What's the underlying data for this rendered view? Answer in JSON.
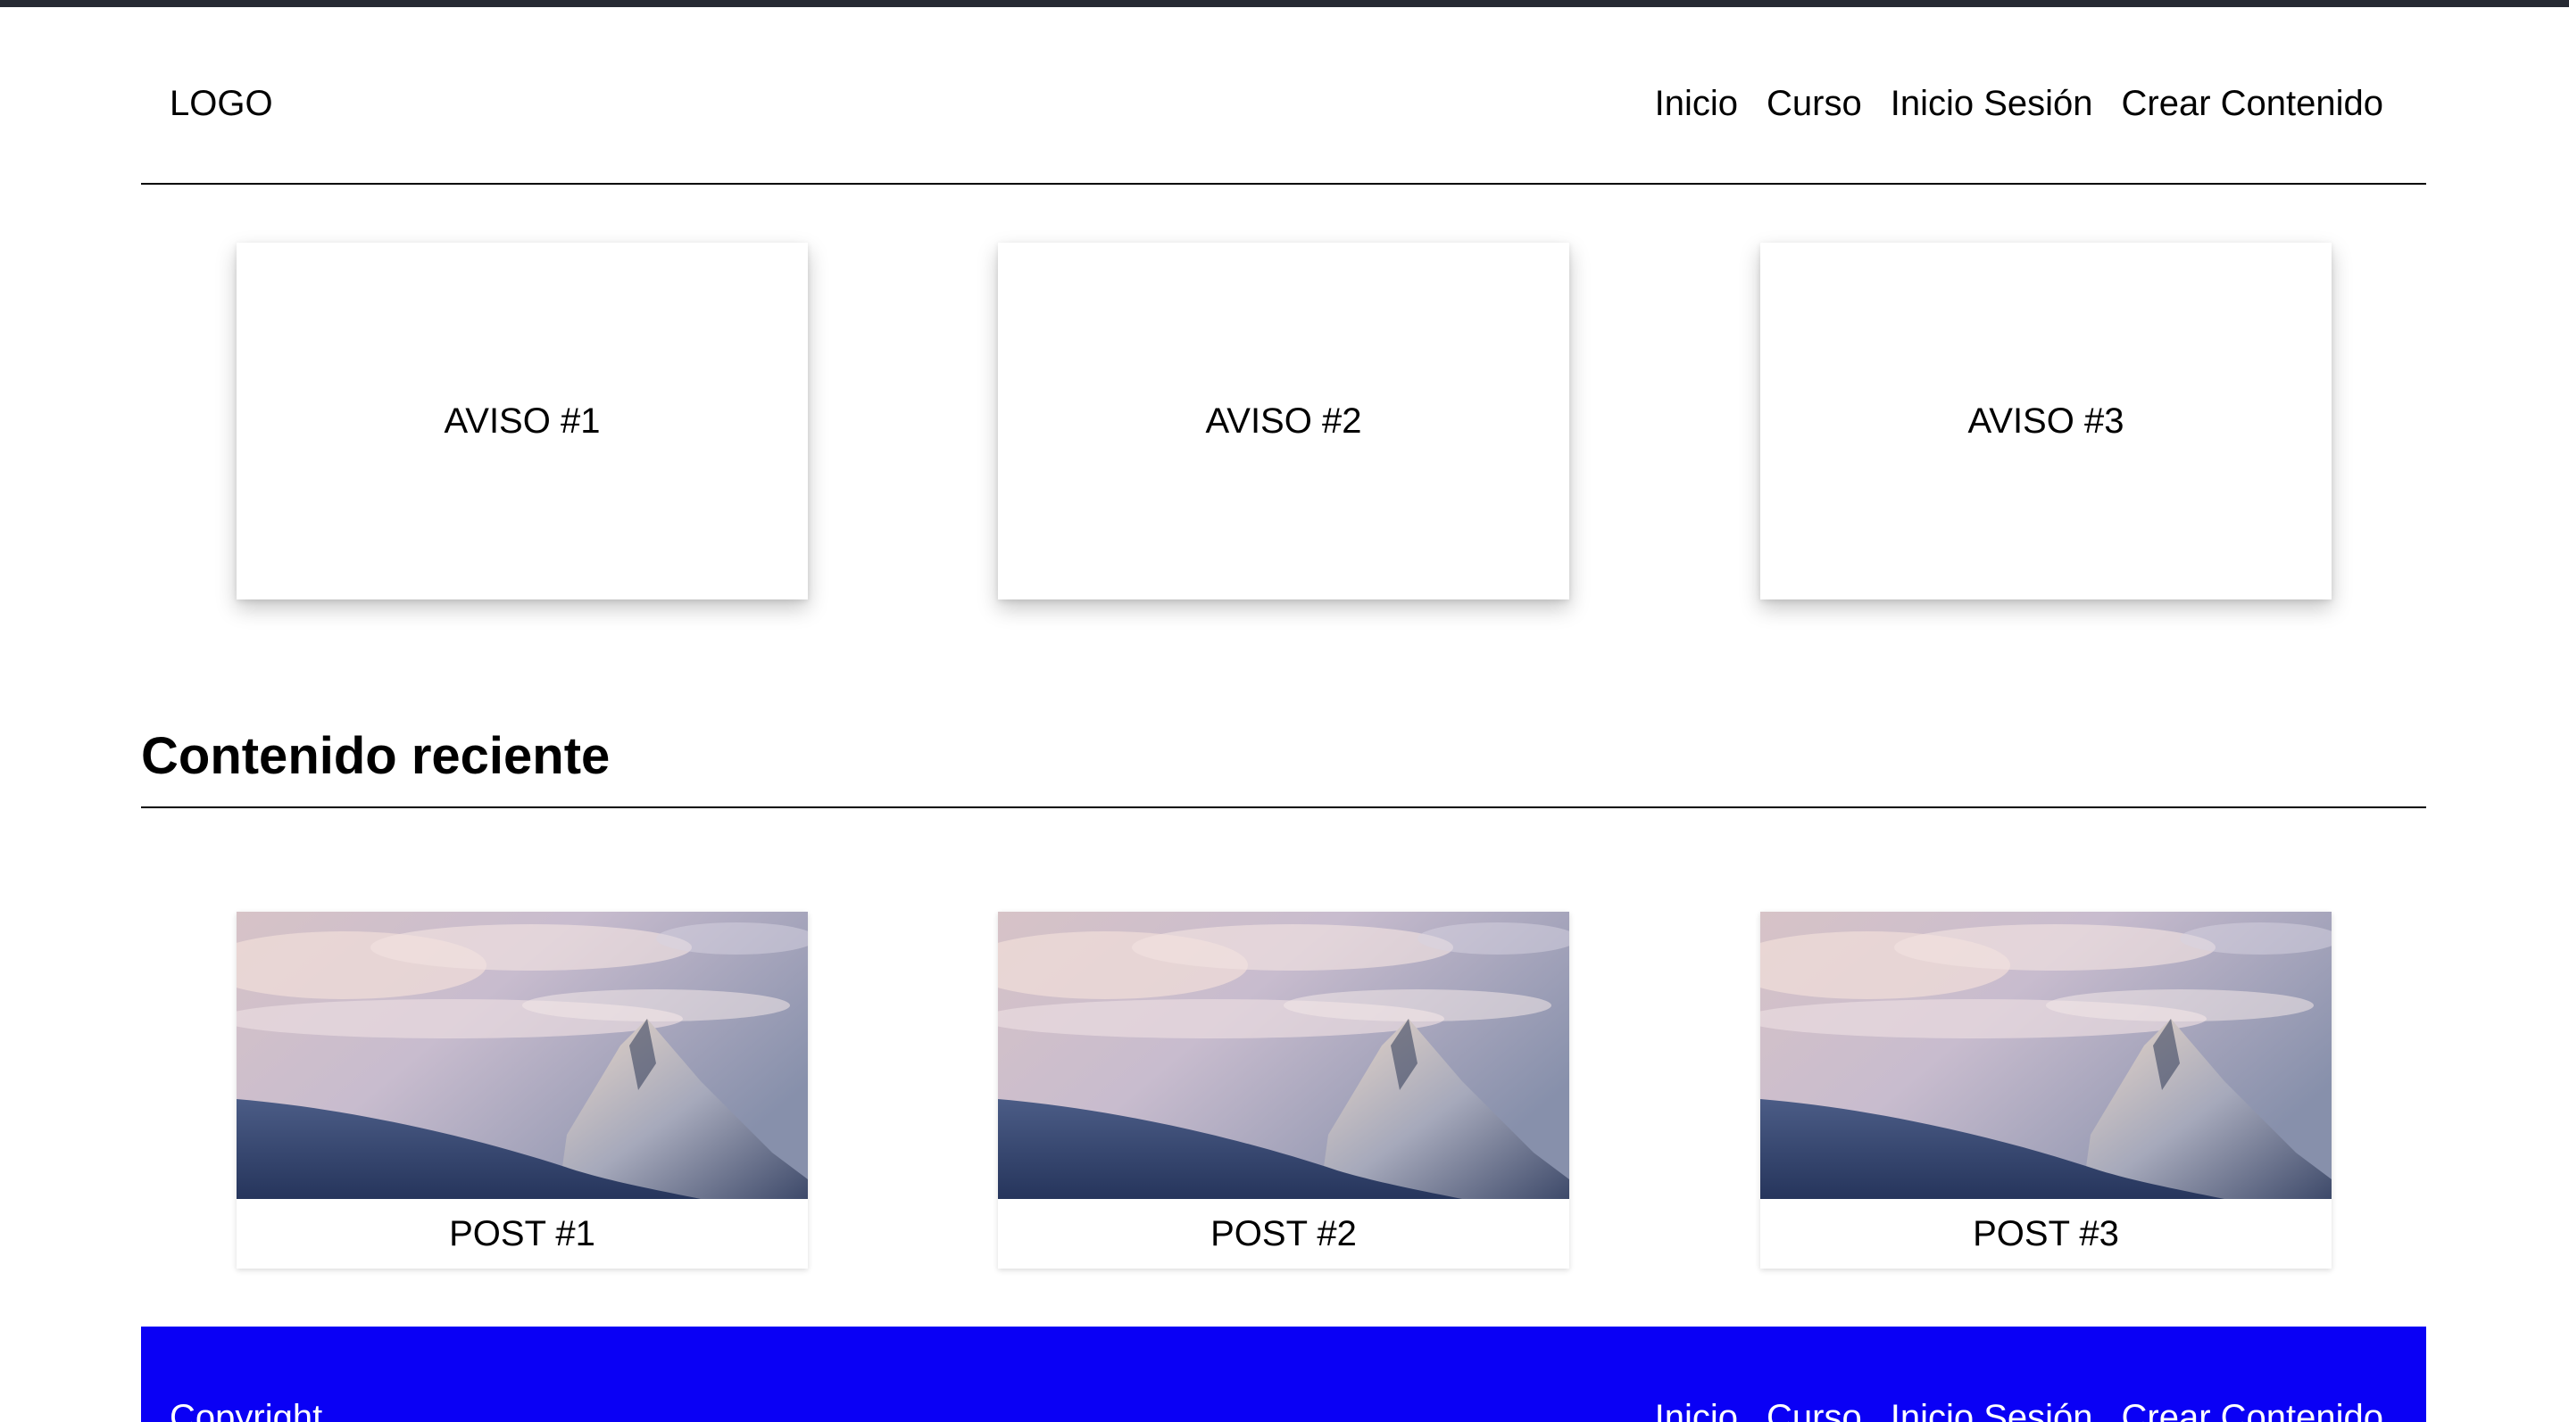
{
  "header": {
    "logo": "LOGO",
    "nav": [
      "Inicio",
      "Curso",
      "Inicio Sesión",
      "Crear Contenido"
    ]
  },
  "notices": [
    "AVISO #1",
    "AVISO #2",
    "AVISO #3"
  ],
  "recent": {
    "title": "Contenido reciente",
    "posts": [
      "POST #1",
      "POST #2",
      "POST #3"
    ]
  },
  "footer": {
    "copyright": "Copyright",
    "nav": [
      "Inicio",
      "Curso",
      "Inicio Sesión",
      "Crear Contenido"
    ]
  },
  "colors": {
    "footer_bg": "#0a00f5",
    "topbar": "#262a33"
  },
  "icons": {
    "post_image": "mountain-landscape-image"
  }
}
